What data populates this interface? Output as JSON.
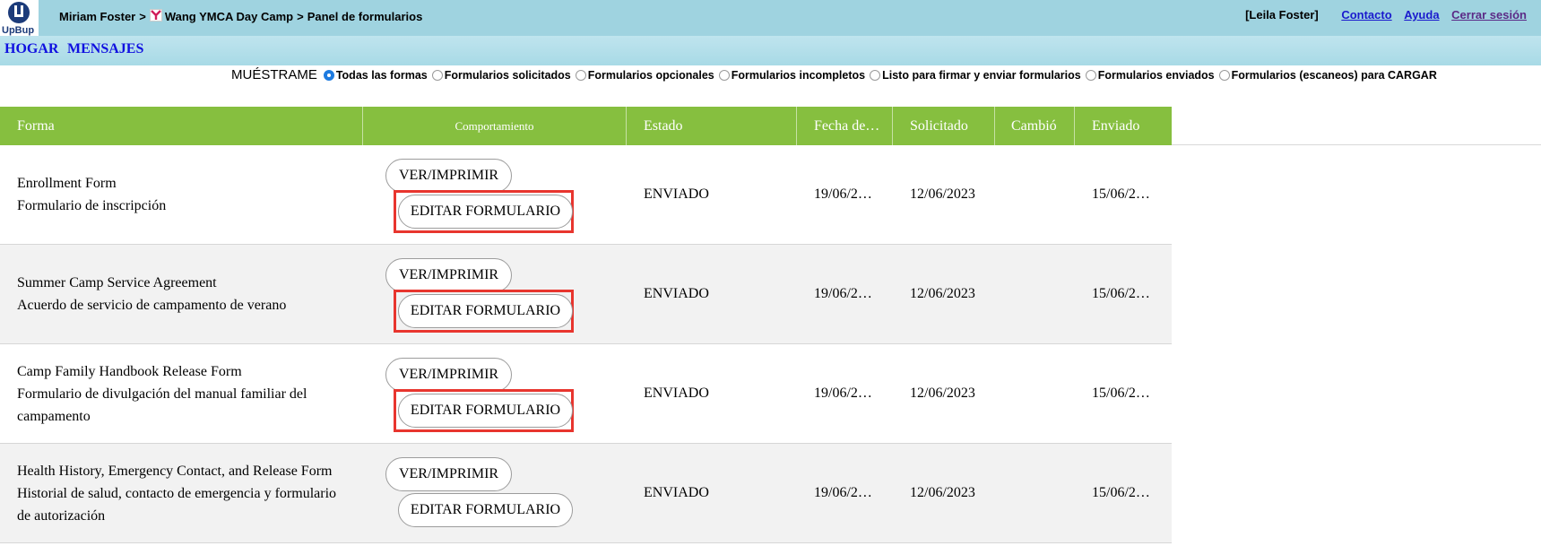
{
  "header": {
    "logo_text": "UpBup",
    "breadcrumb": [
      "Miriam Foster",
      "Wang YMCA Day Camp",
      "Panel de formularios"
    ],
    "breadcrumb_sep": ">",
    "user": "[Leila Foster]",
    "links": [
      "Contacto",
      "Ayuda",
      "Cerrar sesión"
    ]
  },
  "nav": {
    "home": "HOGAR",
    "messages": "MENSAJES"
  },
  "filters": {
    "label": "MUÉSTRAME",
    "options": [
      {
        "label": "Todas las formas",
        "checked": true
      },
      {
        "label": "Formularios solicitados",
        "checked": false
      },
      {
        "label": "Formularios opcionales",
        "checked": false
      },
      {
        "label": "Formularios incompletos",
        "checked": false
      },
      {
        "label": "Listo para firmar y enviar formularios",
        "checked": false
      },
      {
        "label": "Formularios enviados",
        "checked": false
      },
      {
        "label": "Formularios (escaneos) para CARGAR",
        "checked": false
      }
    ]
  },
  "table": {
    "columns": [
      "Forma",
      "Comportamiento",
      "Estado",
      "Fecha de…",
      "Solicitado",
      "Cambió",
      "Enviado"
    ],
    "view_label": "VER/IMPRIMIR",
    "edit_label": "EDITAR FORMULARIO",
    "rows": [
      {
        "name_en": "Enrollment Form",
        "name_es": "Formulario de inscripción",
        "status": "ENVIADO",
        "date": "19/06/2…",
        "requested": "12/06/2023",
        "changed": "",
        "sent": "15/06/2…",
        "highlighted": true
      },
      {
        "name_en": "Summer Camp Service Agreement",
        "name_es": "Acuerdo de servicio de campamento de verano",
        "status": "ENVIADO",
        "date": "19/06/2…",
        "requested": "12/06/2023",
        "changed": "",
        "sent": "15/06/2…",
        "highlighted": true
      },
      {
        "name_en": "Camp Family Handbook Release Form",
        "name_es": "Formulario de divulgación del manual familiar del campamento",
        "status": "ENVIADO",
        "date": "19/06/2…",
        "requested": "12/06/2023",
        "changed": "",
        "sent": "15/06/2…",
        "highlighted": true
      },
      {
        "name_en": "Health History, Emergency Contact, and Release Form",
        "name_es": "Historial de salud, contacto de emergencia y formulario de autorización",
        "status": "ENVIADO",
        "date": "19/06/2…",
        "requested": "12/06/2023",
        "changed": "",
        "sent": "15/06/2…",
        "highlighted": false
      }
    ]
  },
  "colors": {
    "topbar": "#9fd3e0",
    "header_green": "#86bf3f",
    "link_blue": "#1a1acd",
    "highlight_red": "#e8352e",
    "radio_checked": "#1e7be0"
  }
}
